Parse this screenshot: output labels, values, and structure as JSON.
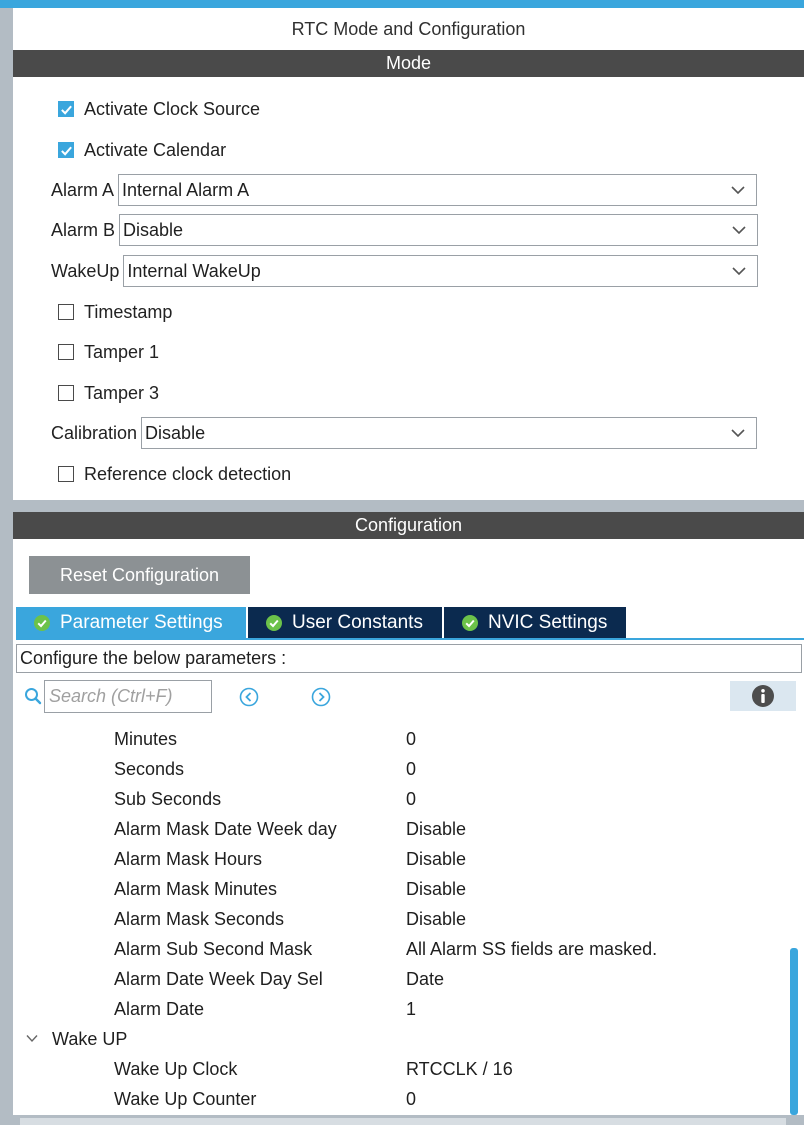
{
  "panel": {
    "title": "RTC Mode and Configuration"
  },
  "mode": {
    "header": "Mode",
    "checkboxes": {
      "activate_clock_source": {
        "label": "Activate Clock Source",
        "checked": true
      },
      "activate_calendar": {
        "label": "Activate Calendar",
        "checked": true
      },
      "timestamp": {
        "label": "Timestamp",
        "checked": false
      },
      "tamper1": {
        "label": "Tamper 1",
        "checked": false
      },
      "tamper3": {
        "label": "Tamper 3",
        "checked": false
      },
      "reference_clock": {
        "label": "Reference clock detection",
        "checked": false
      }
    },
    "selects": {
      "alarm_a": {
        "label": "Alarm A",
        "value": "Internal Alarm A"
      },
      "alarm_b": {
        "label": "Alarm B",
        "value": "Disable"
      },
      "wakeup": {
        "label": "WakeUp",
        "value": "Internal WakeUp"
      },
      "calibration": {
        "label": "Calibration",
        "value": "Disable"
      }
    }
  },
  "configuration": {
    "header": "Configuration",
    "reset_label": "Reset Configuration",
    "tabs": [
      {
        "label": "Parameter Settings",
        "active": true
      },
      {
        "label": "User Constants",
        "active": false
      },
      {
        "label": "NVIC Settings",
        "active": false
      }
    ],
    "description": "Configure the below parameters :",
    "search": {
      "placeholder": "Search (Ctrl+F)"
    },
    "params": [
      {
        "name": "Minutes",
        "value": "0"
      },
      {
        "name": "Seconds",
        "value": "0"
      },
      {
        "name": "Sub Seconds",
        "value": "0"
      },
      {
        "name": "Alarm Mask Date Week day",
        "value": "Disable"
      },
      {
        "name": "Alarm Mask Hours",
        "value": "Disable"
      },
      {
        "name": "Alarm Mask Minutes",
        "value": "Disable"
      },
      {
        "name": "Alarm Mask Seconds",
        "value": "Disable"
      },
      {
        "name": "Alarm Sub Second Mask",
        "value": "All Alarm SS fields are masked."
      },
      {
        "name": "Alarm Date Week Day Sel",
        "value": "Date"
      },
      {
        "name": "Alarm Date",
        "value": "1"
      }
    ],
    "wakeup_group": {
      "label": "Wake UP",
      "params": [
        {
          "name": "Wake Up Clock",
          "value": "RTCCLK / 16"
        },
        {
          "name": "Wake Up Counter",
          "value": "0"
        }
      ]
    }
  },
  "icons": {
    "checkbox_check": "check-icon",
    "dropdown": "chevron-down-icon",
    "tab_status": "check-circle-icon",
    "search": "search-icon",
    "prev": "arrow-left-circle-icon",
    "next": "arrow-right-circle-icon",
    "info": "info-icon"
  },
  "colors": {
    "accent": "#3aa6dd",
    "section_header": "#4a4a4a",
    "tab_inactive": "#0b2a4f",
    "button_gray": "#8c9194",
    "tab_status_ok": "#6cc24a"
  }
}
